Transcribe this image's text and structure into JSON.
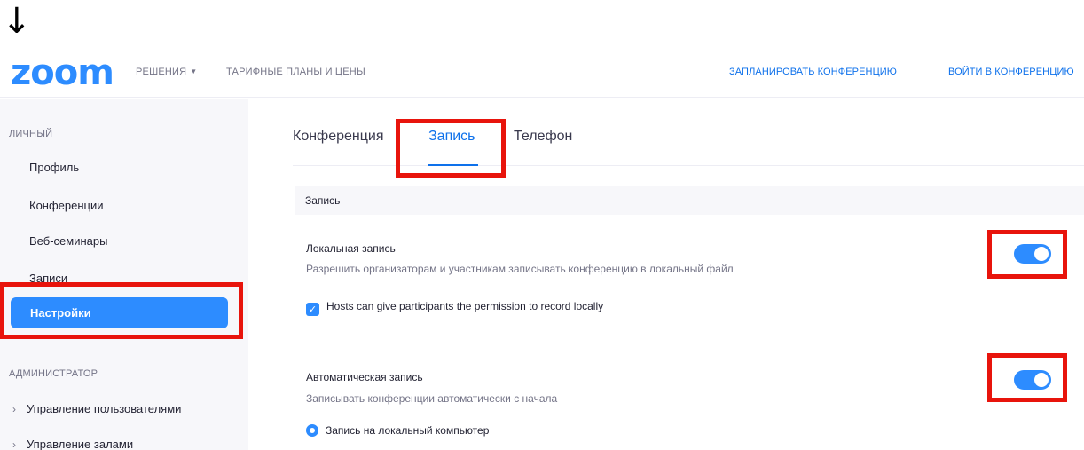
{
  "annotation": {
    "arrow": "↓"
  },
  "header": {
    "logo": "zoom",
    "nav": {
      "solutions": "РЕШЕНИЯ",
      "plans": "ТАРИФНЫЕ ПЛАНЫ И ЦЕНЫ",
      "schedule": "ЗАПЛАНИРОВАТЬ КОНФЕРЕНЦИЮ",
      "join": "ВОЙТИ В КОНФЕРЕНЦИЮ"
    }
  },
  "sidebar": {
    "personal_label": "ЛИЧНЫЙ",
    "items": {
      "profile": "Профиль",
      "meetings": "Конференции",
      "webinars": "Веб-семинары",
      "recordings": "Записи",
      "settings": "Настройки"
    },
    "admin_label": "АДМИНИСТРАТОР",
    "admin_items": {
      "users": "Управление пользователями",
      "rooms": "Управление залами"
    }
  },
  "tabs": {
    "meeting": "Конференция",
    "recording": "Запись",
    "phone": "Телефон",
    "active": "recording"
  },
  "section": {
    "title": "Запись"
  },
  "settings": {
    "local": {
      "title": "Локальная запись",
      "description": "Разрешить организаторам и участникам записывать конференцию в локальный файл",
      "enabled": true,
      "option": {
        "label": "Hosts can give participants the permission to record locally",
        "checked": true
      }
    },
    "auto": {
      "title": "Автоматическая запись",
      "description": "Записывать конференции автоматически с начала",
      "enabled": true,
      "option": {
        "label": "Запись на локальный компьютер",
        "selected": true
      }
    }
  },
  "colors": {
    "accent": "#2d8cff",
    "link": "#0e71eb",
    "highlight": "#e8140c"
  }
}
